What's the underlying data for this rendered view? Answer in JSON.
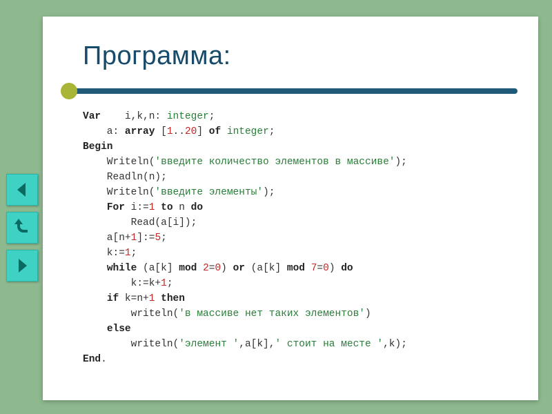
{
  "title": "Программа:",
  "code": {
    "l1": {
      "kw1": "Var",
      "vars": "    i,k,n: ",
      "ty1": "integer",
      "sc": ";"
    },
    "l2": {
      "pre": "    a: ",
      "kw": "array",
      "mid": " [",
      "n1": "1",
      "dd": "..",
      "n2": "20",
      "br": "] ",
      "kw2": "of",
      "sp": " ",
      "ty": "integer",
      "sc": ";"
    },
    "l3": {
      "kw": "Begin"
    },
    "l4": {
      "pre": "    Writeln(",
      "s": "'введите количество элементов в массиве'",
      "post": ");"
    },
    "l5": {
      "txt": "    Readln(n);"
    },
    "l6": {
      "pre": "    Writeln(",
      "s": "'введите элементы'",
      "post": ");"
    },
    "l7": {
      "pre": "    ",
      "kw1": "For",
      "mid1": " i:=",
      "n1": "1",
      "sp": " ",
      "kw2": "to",
      "mid2": " n ",
      "kw3": "do"
    },
    "l8": {
      "txt": "        Read(a[i]);"
    },
    "l9": {
      "pre": "    a[n+",
      "n1": "1",
      "mid": "]:=",
      "n2": "5",
      "sc": ";"
    },
    "l10": {
      "pre": "    k:=",
      "n": "1",
      "sc": ";"
    },
    "l11": {
      "pre": "    ",
      "kw1": "while",
      "mid1": " (a[k] ",
      "kw2": "mod",
      "sp1": " ",
      "n1": "2",
      "eq1": "=",
      "n2": "0",
      "br1": ") ",
      "kw3": "or",
      "mid2": " (a[k] ",
      "kw4": "mod",
      "sp2": " ",
      "n3": "7",
      "eq2": "=",
      "n4": "0",
      "br2": ") ",
      "kw5": "do"
    },
    "l12": {
      "pre": "        k:=k+",
      "n": "1",
      "sc": ";"
    },
    "l13": {
      "pre": "    ",
      "kw1": "if",
      "mid1": " k=n+",
      "n": "1",
      "sp": " ",
      "kw2": "then"
    },
    "l14": {
      "pre": "        writeln(",
      "s": "'в массиве нет таких элементов'",
      "post": ")"
    },
    "l15": {
      "pre": "    ",
      "kw": "else"
    },
    "l16": {
      "pre": "        writeln(",
      "s1": "'элемент '",
      "mid": ",a[k],",
      "s2": "' стоит на месте '",
      "post": ",k);"
    },
    "l17": {
      "kw": "End",
      "dot": "."
    }
  },
  "nav": {
    "prev": "prev",
    "next": "next",
    "return": "return"
  }
}
